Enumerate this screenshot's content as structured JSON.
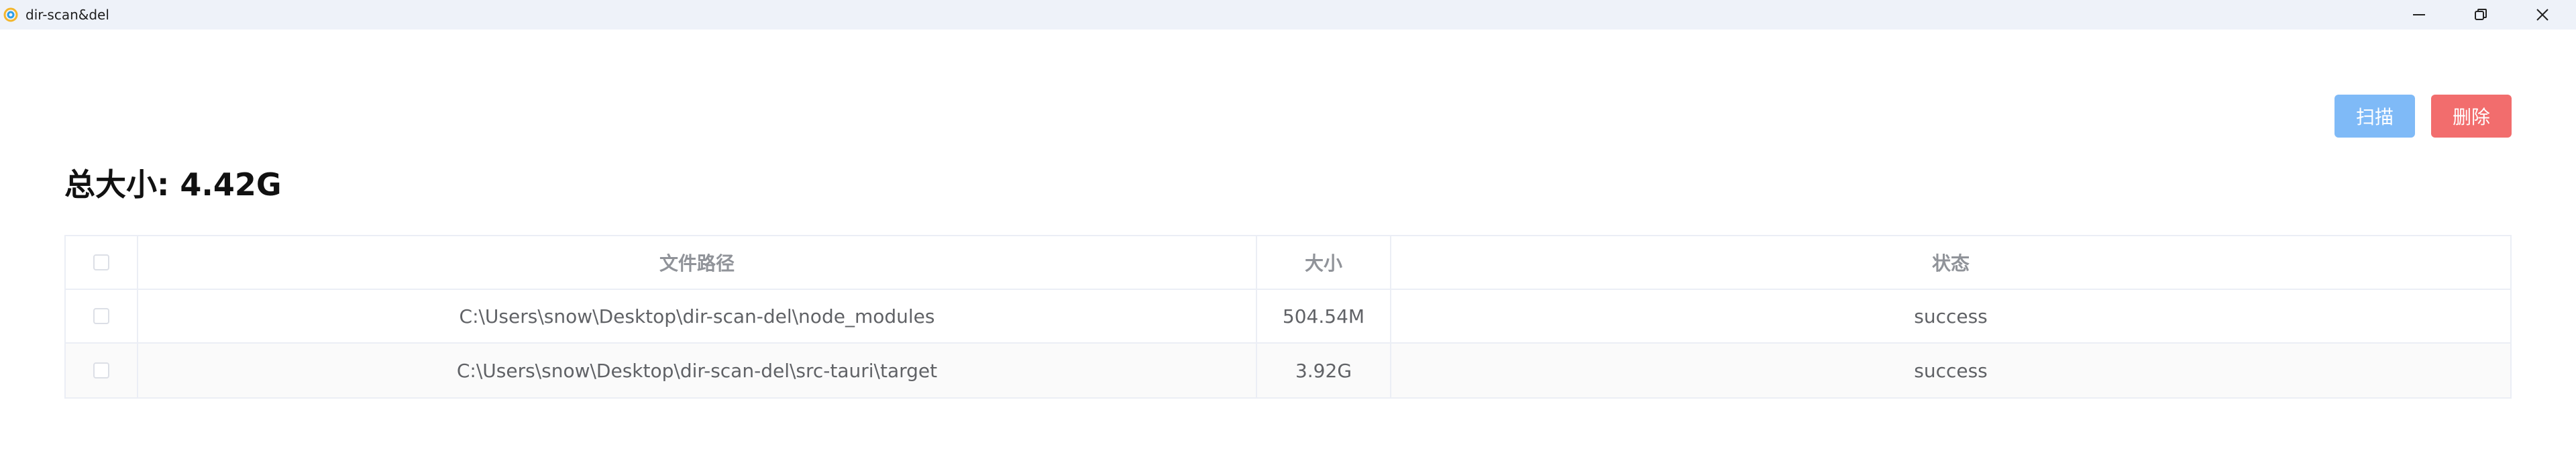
{
  "window": {
    "title": "dir-scan&del"
  },
  "toolbar": {
    "scan_label": "扫描",
    "delete_label": "删除",
    "scan_color": "#7fbaf7",
    "delete_color": "#f26d6d"
  },
  "summary": {
    "total_size": "总大小: 4.42G"
  },
  "table": {
    "columns": [
      "文件路径",
      "大小",
      "状态"
    ],
    "rows": [
      {
        "path": "C:\\Users\\snow\\Desktop\\dir-scan-del\\node_modules",
        "size": "504.54M",
        "status": "success",
        "checked": false
      },
      {
        "path": "C:\\Users\\snow\\Desktop\\dir-scan-del\\src-tauri\\target",
        "size": "3.92G",
        "status": "success",
        "checked": false
      }
    ]
  },
  "icons": {
    "app": "app-logo-icon",
    "minimize": "minimize-icon",
    "maximize": "restore-icon",
    "close": "close-icon"
  }
}
